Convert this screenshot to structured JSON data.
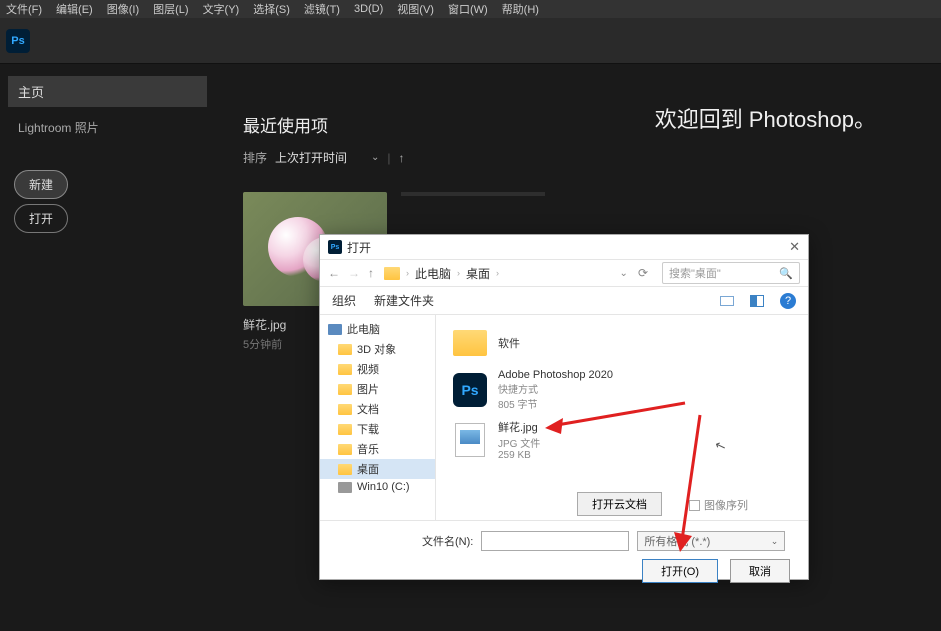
{
  "menubar": [
    "文件(F)",
    "编辑(E)",
    "图像(I)",
    "图层(L)",
    "文字(Y)",
    "选择(S)",
    "滤镜(T)",
    "3D(D)",
    "视图(V)",
    "窗口(W)",
    "帮助(H)"
  ],
  "sidebar": {
    "home": "主页",
    "lightroom": "Lightroom 照片",
    "new_btn": "新建",
    "open_btn": "打开"
  },
  "welcome": "欢迎回到 Photoshop。",
  "recent": {
    "title": "最近使用项",
    "sort_label": "排序",
    "sort_value": "上次打开时间"
  },
  "thumb": {
    "name": "鲜花.jpg",
    "time": "5分钟前"
  },
  "dialog": {
    "title": "打开",
    "path": [
      "此电脑",
      "桌面"
    ],
    "search_placeholder": "搜索\"桌面\"",
    "org": "组织",
    "new_folder": "新建文件夹",
    "tree": [
      "此电脑",
      "3D 对象",
      "视频",
      "图片",
      "文档",
      "下载",
      "音乐",
      "桌面",
      "Win10 (C:)"
    ],
    "files": [
      {
        "name": "软件",
        "type": "folder"
      },
      {
        "name": "Adobe Photoshop 2020",
        "sub1": "快捷方式",
        "sub2": "805 字节",
        "type": "ps"
      },
      {
        "name": "鲜花.jpg",
        "sub1": "JPG 文件",
        "sub2": "259 KB",
        "type": "img"
      }
    ],
    "cloud_btn": "打开云文档",
    "seq": "图像序列",
    "file_label": "文件名(N):",
    "type_label": "所有格式 (*.*)",
    "open_btn": "打开(O)",
    "cancel_btn": "取消"
  }
}
